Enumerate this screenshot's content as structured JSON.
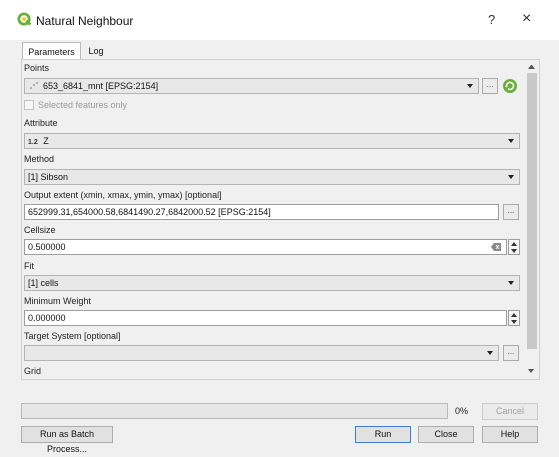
{
  "window": {
    "title": "Natural Neighbour",
    "help": "?",
    "close": "×"
  },
  "tabs": [
    {
      "label": "Parameters"
    },
    {
      "label": "Log"
    }
  ],
  "form": {
    "points": {
      "label": "Points",
      "value": "653_6841_mnt [EPSG:2154]",
      "button": "...",
      "selected_only": "Selected features only"
    },
    "attribute": {
      "label": "Attribute",
      "prefix": "1.2",
      "value": "Z"
    },
    "method": {
      "label": "Method",
      "value": "[1] Sibson"
    },
    "output_extent": {
      "label": "Output extent (xmin, xmax, ymin, ymax) [optional]",
      "value": "652999.31,654000.58,6841490.27,6842000.52 [EPSG:2154]",
      "button": "..."
    },
    "cellsize": {
      "label": "Cellsize",
      "value": "0.500000"
    },
    "fit": {
      "label": "Fit",
      "value": "[1] cells"
    },
    "minimum_weight": {
      "label": "Minimum Weight",
      "value": "0.000000"
    },
    "target_system": {
      "label": "Target System [optional]",
      "value": "",
      "button": "..."
    },
    "grid": {
      "label": "Grid"
    }
  },
  "progress": {
    "value": 0,
    "label": "0%"
  },
  "buttons": {
    "cancel": "Cancel",
    "batch": "Run as Batch Process...",
    "run": "Run",
    "close": "Close",
    "help": "Help"
  },
  "colors": {
    "qgis_green": "#6bb03b",
    "accent": "#3b7ddd"
  },
  "icons": {
    "app": "qgis-icon",
    "layer": "point-layer-icon",
    "iterate": "iterate-icon",
    "clear": "clear-icon"
  }
}
